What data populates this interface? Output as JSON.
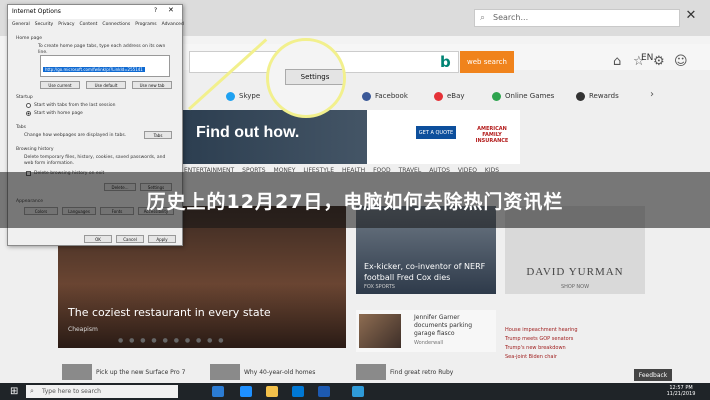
{
  "browser": {
    "search_placeholder": "Search...",
    "search_icon": "search-icon",
    "language": "EN",
    "window_controls": [
      "─",
      "□",
      "✕"
    ]
  },
  "page": {
    "bing_logo": "b",
    "web_search_label": "web search",
    "quick_links": [
      {
        "label": "Skype",
        "color": "#1ea1f1"
      },
      {
        "label": "Facebook",
        "color": "#3b5998"
      },
      {
        "label": "eBay",
        "color": "#e53238"
      },
      {
        "label": "Online Games",
        "color": "#2ea44f"
      },
      {
        "label": "Rewards",
        "color": "#333333"
      }
    ],
    "ad": {
      "title": "Find out how.",
      "quote_btn": "GET A QUOTE",
      "brand": "AMERICAN FAMILY INSURANCE",
      "adchoices": "Ad"
    },
    "nav_categories": [
      "ENTERTAINMENT",
      "SPORTS",
      "MONEY",
      "LIFESTYLE",
      "HEALTH",
      "FOOD",
      "TRAVEL",
      "AUTOS",
      "VIDEO",
      "KIDS"
    ],
    "cards": {
      "main_title": "The coziest restaurant in every state",
      "main_source": "Cheapism",
      "nfl_title": "Ex-kicker, co-inventor of NERF football Fred Cox dies",
      "nfl_source": "FOX SPORTS",
      "yurman_brand": "DAVID YURMAN",
      "yurman_shop": "SHOP NOW",
      "garner_text": "Jennifer Garner documents parking garage fiasco",
      "garner_source": "Wonderwall"
    },
    "headlines": [
      "House impeachment hearing",
      "Trump meets GOP senators",
      "Trump's new breakdown",
      "Sea-joint Biden chair"
    ],
    "bottom_items": [
      "Pick up the new Surface Pro 7",
      "Why 40-year-old homes",
      "Find great retro Ruby"
    ],
    "feedback": "Feedback"
  },
  "dialog": {
    "title": "Internet Options",
    "tabs": [
      "General",
      "Security",
      "Privacy",
      "Content",
      "Connections",
      "Programs",
      "Advanced"
    ],
    "home_page_label": "Home page",
    "home_page_hint": "To create home page tabs, type each address on its own line.",
    "home_url": "http://go.microsoft.com/fwlink/p/?LinkId=255141",
    "use_current": "Use current",
    "use_default": "Use default",
    "use_new_tab": "Use new tab",
    "startup_label": "Startup",
    "startup_opt1": "Start with tabs from the last session",
    "startup_opt2": "Start with home page",
    "tabs_label": "Tabs",
    "tabs_hint": "Change how webpages are displayed in tabs.",
    "tabs_btn": "Tabs",
    "history_label": "Browsing history",
    "history_hint": "Delete temporary files, history, cookies, saved passwords, and web form information.",
    "delete_on_exit": "Delete browsing history on exit",
    "delete_btn": "Delete...",
    "settings_btn": "Settings",
    "appearance_label": "Appearance",
    "colors_btn": "Colors",
    "languages_btn": "Languages",
    "fonts_btn": "Fonts",
    "accessibility_btn": "Accessibility",
    "ok": "OK",
    "cancel": "Cancel",
    "apply": "Apply",
    "help": "?",
    "close": "✕"
  },
  "magnifier": {
    "settings_label": "Settings",
    "border_color": "#f2f08d"
  },
  "overlay": {
    "title": "历史上的12月27日，电脑如何去除热门资讯栏"
  },
  "taskbar": {
    "search_placeholder": "Type here to search",
    "time": "12:57 PM",
    "date": "11/21/2019"
  }
}
